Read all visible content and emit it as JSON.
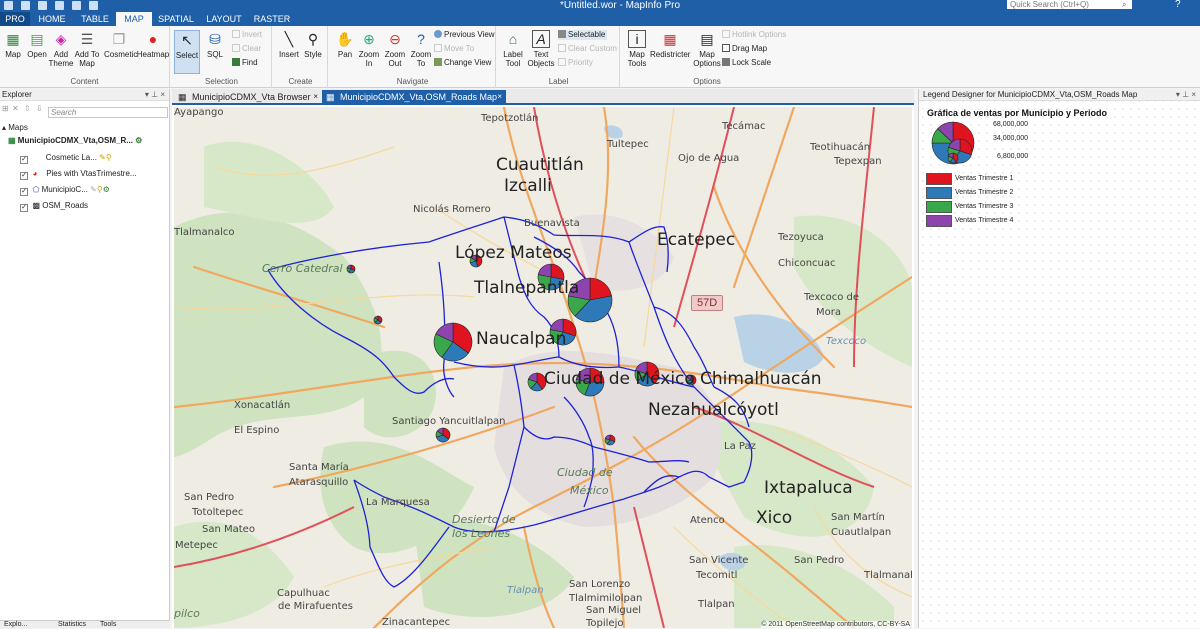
{
  "app": {
    "window_title": "*Untitled.wor - MapInfo Pro",
    "search_placeholder": "Quick Search (Ctrl+Q)",
    "help": "?"
  },
  "tabs": [
    {
      "label": "PRO"
    },
    {
      "label": "HOME"
    },
    {
      "label": "TABLE"
    },
    {
      "label": "MAP"
    },
    {
      "label": "SPATIAL"
    },
    {
      "label": "LAYOUT"
    },
    {
      "label": "RASTER"
    }
  ],
  "ribbon": {
    "content": {
      "label": "Content",
      "map": "Map",
      "open": "Open",
      "add_theme": "Add Theme",
      "add_to_map": "Add To Map",
      "cosmetic": "Cosmetic",
      "heatmap": "Heatmap"
    },
    "selection": {
      "label": "Selection",
      "select": "Select",
      "sql": "SQL",
      "invert": "Invert",
      "clear": "Clear",
      "find": "Find"
    },
    "create": {
      "label": "Create",
      "insert": "Insert",
      "style": "Style"
    },
    "navigate": {
      "label": "Navigate",
      "pan": "Pan",
      "zoom_in": "Zoom In",
      "zoom_out": "Zoom Out",
      "zoom_to": "Zoom To",
      "previous_view": "Previous View",
      "move_to": "Move To",
      "change_view": "Change View"
    },
    "label": {
      "label": "Label",
      "label_tool": "Label Tool",
      "text_objects": "Text Objects",
      "selectable": "Selectable",
      "clear_custom": "Clear Custom",
      "priority": "Priority"
    },
    "options": {
      "label": "Options",
      "map_tools": "Map Tools",
      "redistricter": "Redistricter",
      "map_options": "Map Options",
      "hotlink_options": "Hotlink Options",
      "drag_map": "Drag Map",
      "lock_scale": "Lock Scale"
    }
  },
  "explorer": {
    "title": "Explorer",
    "search_placeholder": "Search",
    "maps_node": "Maps",
    "map_name": "MunicipioCDMX_Vta,OSM_R...",
    "layers": [
      {
        "name": "Cosmetic La...",
        "checked": true
      },
      {
        "name": "Pies with VtasTrimestre...",
        "checked": true
      },
      {
        "name": "MunicipioC...",
        "checked": true
      },
      {
        "name": "OSM_Roads",
        "checked": true
      }
    ],
    "bottom_tabs": [
      "Explo...",
      "Statistics",
      "Tools"
    ]
  },
  "documents": {
    "tabs": [
      {
        "label": "MunicipioCDMX_Vta Browser",
        "close": "×",
        "active": false
      },
      {
        "label": "MunicipioCDMX_Vta,OSM_Roads Map",
        "close": "×",
        "active": true
      }
    ]
  },
  "map": {
    "places": [
      {
        "name": "Tepotzotlán",
        "size": "sm"
      },
      {
        "name": "Tultepec",
        "size": "sm"
      },
      {
        "name": "Tecámac",
        "size": "sm"
      },
      {
        "name": "Cuautitlán",
        "size": "big"
      },
      {
        "name": "Ojo de Agua",
        "size": "sm"
      },
      {
        "name": "Teotihuacán",
        "size": "sm"
      },
      {
        "name": "Izcalli",
        "size": "big"
      },
      {
        "name": "Tepexpan",
        "size": "sm"
      },
      {
        "name": "Nicolás Romero",
        "size": "sm"
      },
      {
        "name": "Buenavista",
        "size": "sm"
      },
      {
        "name": "Ecatepec",
        "size": "big"
      },
      {
        "name": "Tezoyuca",
        "size": "sm"
      },
      {
        "name": "Cerro Catedral",
        "size": "it"
      },
      {
        "name": "López Mateos",
        "size": "big"
      },
      {
        "name": "Chiconcuac",
        "size": "sm"
      },
      {
        "name": "Tlalnepantla",
        "size": "big"
      },
      {
        "name": "Texcoco de",
        "size": "sm"
      },
      {
        "name": "Mora",
        "size": "sm"
      },
      {
        "name": "Naucalpan",
        "size": "big"
      },
      {
        "name": "Texcoco",
        "size": "water"
      },
      {
        "name": "Xonacatlán",
        "size": "sm"
      },
      {
        "name": "Ciudad de México",
        "size": "big"
      },
      {
        "name": "Chimalhuacán",
        "size": "big"
      },
      {
        "name": "Nezahualcóyotl",
        "size": "big"
      },
      {
        "name": "El Espino",
        "size": "sm"
      },
      {
        "name": "Santiago Yancuitlalpan",
        "size": "sm"
      },
      {
        "name": "La Paz",
        "size": "sm"
      },
      {
        "name": "Santa María",
        "size": "sm"
      },
      {
        "name": "Atarasquillo",
        "size": "sm"
      },
      {
        "name": "Ciudad de",
        "size": "it"
      },
      {
        "name": "México",
        "size": "it"
      },
      {
        "name": "San Pedro",
        "size": "sm"
      },
      {
        "name": "Totoltepec",
        "size": "sm"
      },
      {
        "name": "Ixtapaluca",
        "size": "big"
      },
      {
        "name": "La Marquesa",
        "size": "sm"
      },
      {
        "name": "Desierto de",
        "size": "it"
      },
      {
        "name": "los Leones",
        "size": "it"
      },
      {
        "name": "Xico",
        "size": "big"
      },
      {
        "name": "San Martín",
        "size": "sm"
      },
      {
        "name": "Cuautlalpan",
        "size": "sm"
      },
      {
        "name": "San Mateo",
        "size": "sm"
      },
      {
        "name": "Atenco",
        "size": "sm"
      },
      {
        "name": "Metepec",
        "size": "sm"
      },
      {
        "name": "Tlalpan",
        "size": "water"
      },
      {
        "name": "San Vicente",
        "size": "sm"
      },
      {
        "name": "Tecomitl",
        "size": "sm"
      },
      {
        "name": "San Pedro",
        "size": "sm"
      },
      {
        "name": "Capulhuac",
        "size": "sm"
      },
      {
        "name": "de Mirafuentes",
        "size": "sm"
      },
      {
        "name": "San Lorenzo",
        "size": "sm"
      },
      {
        "name": "Tlalmimilolpan",
        "size": "sm"
      },
      {
        "name": "San Miguel",
        "size": "sm"
      },
      {
        "name": "Topilejo",
        "size": "sm"
      },
      {
        "name": "Zinacantepec",
        "size": "sm"
      },
      {
        "name": "Tlalpan",
        "size": "sm"
      },
      {
        "name": "Tlalmanalco",
        "size": "sm"
      },
      {
        "name": "Tlalmanalco",
        "size": "sm"
      },
      {
        "name": "pilco",
        "size": "it"
      },
      {
        "name": "Ayapango",
        "size": "sm"
      }
    ],
    "highway_shield": "57D",
    "attribution": "© 2011 OpenStreetMap contributors, CC-BY-SA",
    "pies": [
      {
        "q": [
          0.22,
          0.4,
          0.16,
          0.22
        ]
      },
      {
        "q": [
          0.35,
          0.25,
          0.22,
          0.18
        ]
      },
      {
        "q": [
          0.28,
          0.24,
          0.26,
          0.22
        ]
      },
      {
        "q": [
          0.3,
          0.28,
          0.2,
          0.22
        ]
      },
      {
        "q": [
          0.26,
          0.3,
          0.22,
          0.22
        ]
      },
      {
        "q": [
          0.4,
          0.25,
          0.15,
          0.2
        ]
      },
      {
        "q": [
          0.4,
          0.22,
          0.18,
          0.2
        ]
      },
      {
        "q": [
          0.3,
          0.3,
          0.2,
          0.2
        ]
      },
      {
        "q": [
          0.45,
          0.25,
          0.15,
          0.15
        ]
      },
      {
        "q": [
          0.35,
          0.3,
          0.2,
          0.15
        ]
      },
      {
        "q": [
          0.3,
          0.3,
          0.2,
          0.2
        ]
      },
      {
        "q": [
          0.4,
          0.3,
          0.15,
          0.15
        ]
      },
      {
        "q": [
          0.35,
          0.35,
          0.15,
          0.15
        ]
      }
    ]
  },
  "legend": {
    "panel_title": "Legend Designer for MunicipioCDMX_Vta,OSM_Roads Map",
    "chart_title": "Gráfica de ventas por Municipio y Periodo",
    "sizes": [
      "68,000,000",
      "34,000,000",
      "6,800,000"
    ],
    "entries": [
      {
        "label": "Ventas Trimestre 1",
        "color": "#e0141e"
      },
      {
        "label": "Ventas Trimestre 2",
        "color": "#2e7ab8"
      },
      {
        "label": "Ventas Trimestre 3",
        "color": "#3aa84a"
      },
      {
        "label": "Ventas Trimestre 4",
        "color": "#8e44ad"
      }
    ]
  }
}
